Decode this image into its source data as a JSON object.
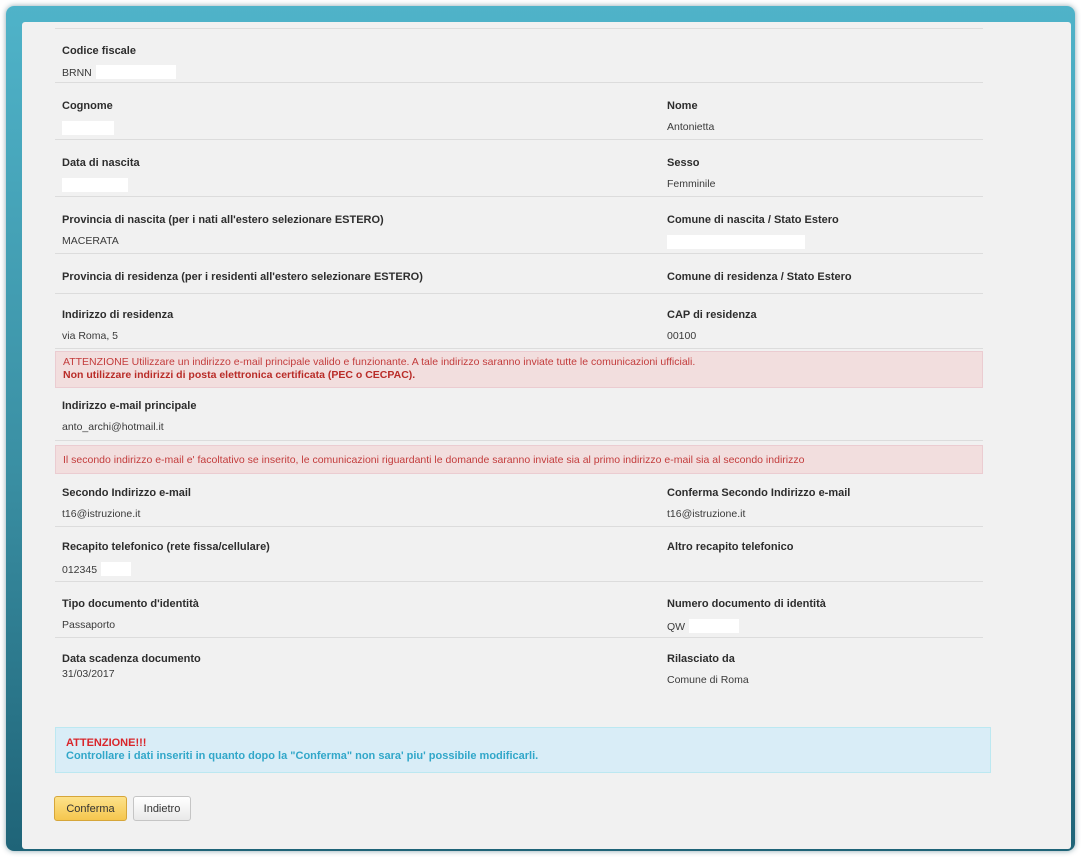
{
  "fields": {
    "codice_fiscale": {
      "label": "Codice fiscale",
      "value": "BRNN"
    },
    "cognome": {
      "label": "Cognome",
      "value": ""
    },
    "nome": {
      "label": "Nome",
      "value": "Antonietta"
    },
    "data_nascita": {
      "label": "Data di nascita",
      "value": ""
    },
    "sesso": {
      "label": "Sesso",
      "value": "Femminile"
    },
    "provincia_nascita": {
      "label": "Provincia di nascita (per i nati all'estero selezionare ESTERO)",
      "value": "MACERATA"
    },
    "comune_nascita": {
      "label": "Comune di nascita / Stato Estero",
      "value": ""
    },
    "provincia_residenza": {
      "label": "Provincia di residenza (per i residenti all'estero selezionare ESTERO)",
      "value": ""
    },
    "comune_residenza": {
      "label": "Comune di residenza / Stato Estero",
      "value": ""
    },
    "indirizzo_residenza": {
      "label": "Indirizzo di residenza",
      "value": "via Roma, 5"
    },
    "cap_residenza": {
      "label": "CAP di residenza",
      "value": "00100"
    },
    "email_principale": {
      "label": "Indirizzo e-mail principale",
      "value": "anto_archi@hotmail.it"
    },
    "secondo_email": {
      "label": "Secondo Indirizzo e-mail",
      "value": "t16@istruzione.it"
    },
    "conferma_secondo_email": {
      "label": "Conferma Secondo Indirizzo e-mail",
      "value": "t16@istruzione.it"
    },
    "recapito_telefonico": {
      "label": "Recapito telefonico (rete fissa/cellulare)",
      "value": "012345"
    },
    "altro_recapito": {
      "label": "Altro recapito telefonico",
      "value": ""
    },
    "tipo_documento": {
      "label": "Tipo documento d'identità",
      "value": "Passaporto"
    },
    "numero_documento": {
      "label": "Numero documento di identità",
      "value": "QW"
    },
    "data_scadenza": {
      "label": "Data scadenza documento",
      "value": "31/03/2017"
    },
    "rilasciato_da": {
      "label": "Rilasciato da",
      "value": "Comune di Roma"
    }
  },
  "alerts": {
    "email_warning": {
      "title": "ATTENZIONE",
      "text": " Utilizzare un indirizzo e-mail principale valido e funzionante. A tale indirizzo saranno inviate tutte le comunicazioni ufficiali.",
      "bold": "Non utilizzare indirizzi di posta elettronica certificata (PEC o CECPAC)."
    },
    "second_email_note": "Il secondo indirizzo e-mail e' facoltativo se inserito, le comunicazioni riguardanti le domande saranno inviate sia al primo indirizzo e-mail sia al secondo indirizzo",
    "confirm_warning": {
      "title": "ATTENZIONE!!!",
      "text": "Controllare i dati inseriti in quanto dopo la \"Conferma\" non sara' piu' possibile modificarli."
    }
  },
  "buttons": {
    "confirm": "Conferma",
    "back": "Indietro"
  },
  "colors": {
    "alert_danger_bg": "#f2dede",
    "alert_info_bg": "#d9edf7",
    "confirm_button": "#f5c64e",
    "frame_accent": "#3a8fa3"
  }
}
